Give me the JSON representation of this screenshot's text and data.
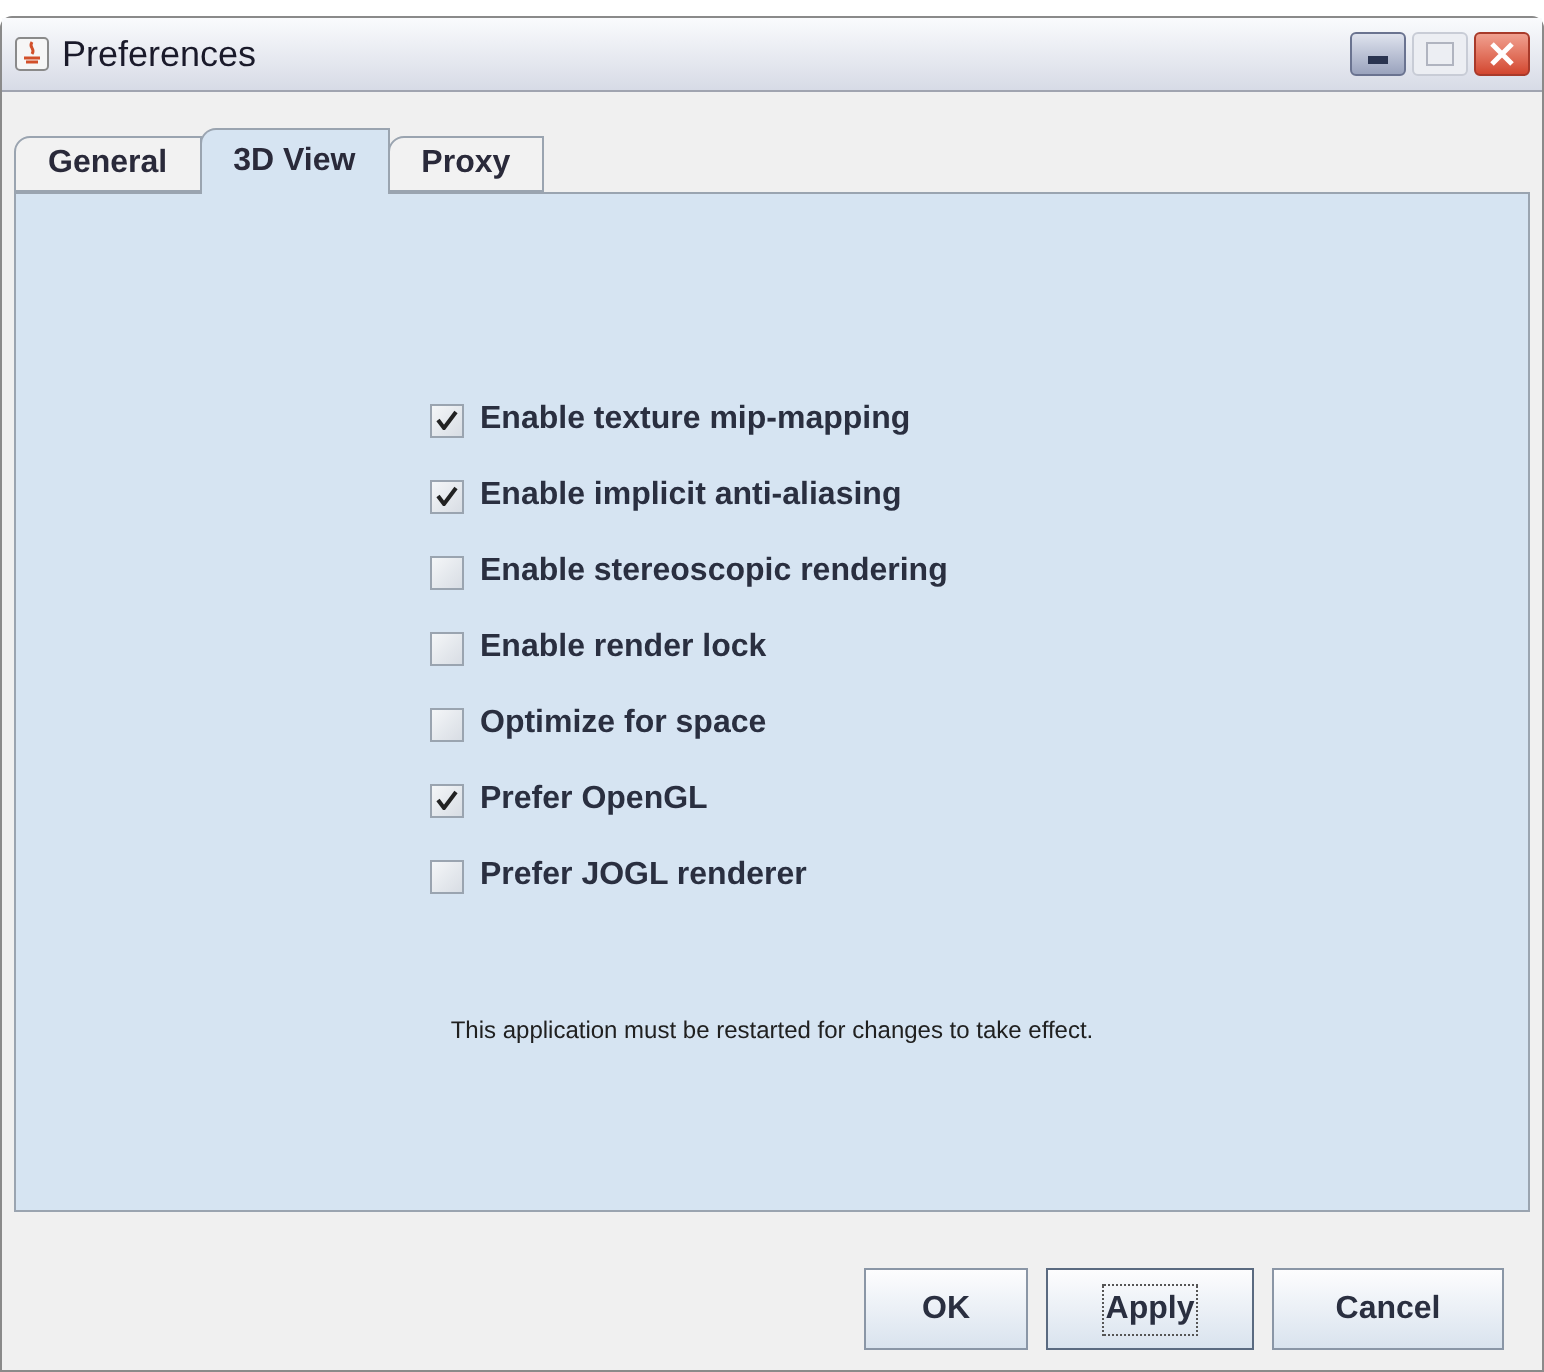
{
  "window": {
    "title": "Preferences"
  },
  "tabs": [
    {
      "label": "General",
      "selected": false
    },
    {
      "label": "3D View",
      "selected": true
    },
    {
      "label": "Proxy",
      "selected": false
    }
  ],
  "options": [
    {
      "label": "Enable texture mip-mapping",
      "checked": true
    },
    {
      "label": "Enable implicit anti-aliasing",
      "checked": true
    },
    {
      "label": "Enable stereoscopic rendering",
      "checked": false
    },
    {
      "label": "Enable render lock",
      "checked": false
    },
    {
      "label": "Optimize for space",
      "checked": false
    },
    {
      "label": "Prefer OpenGL",
      "checked": true
    },
    {
      "label": "Prefer JOGL renderer",
      "checked": false
    }
  ],
  "note": "This application must be restarted for changes to take effect.",
  "buttons": [
    {
      "label": "OK",
      "focused": false
    },
    {
      "label": "Apply",
      "focused": true
    },
    {
      "label": "Cancel",
      "focused": false
    }
  ]
}
